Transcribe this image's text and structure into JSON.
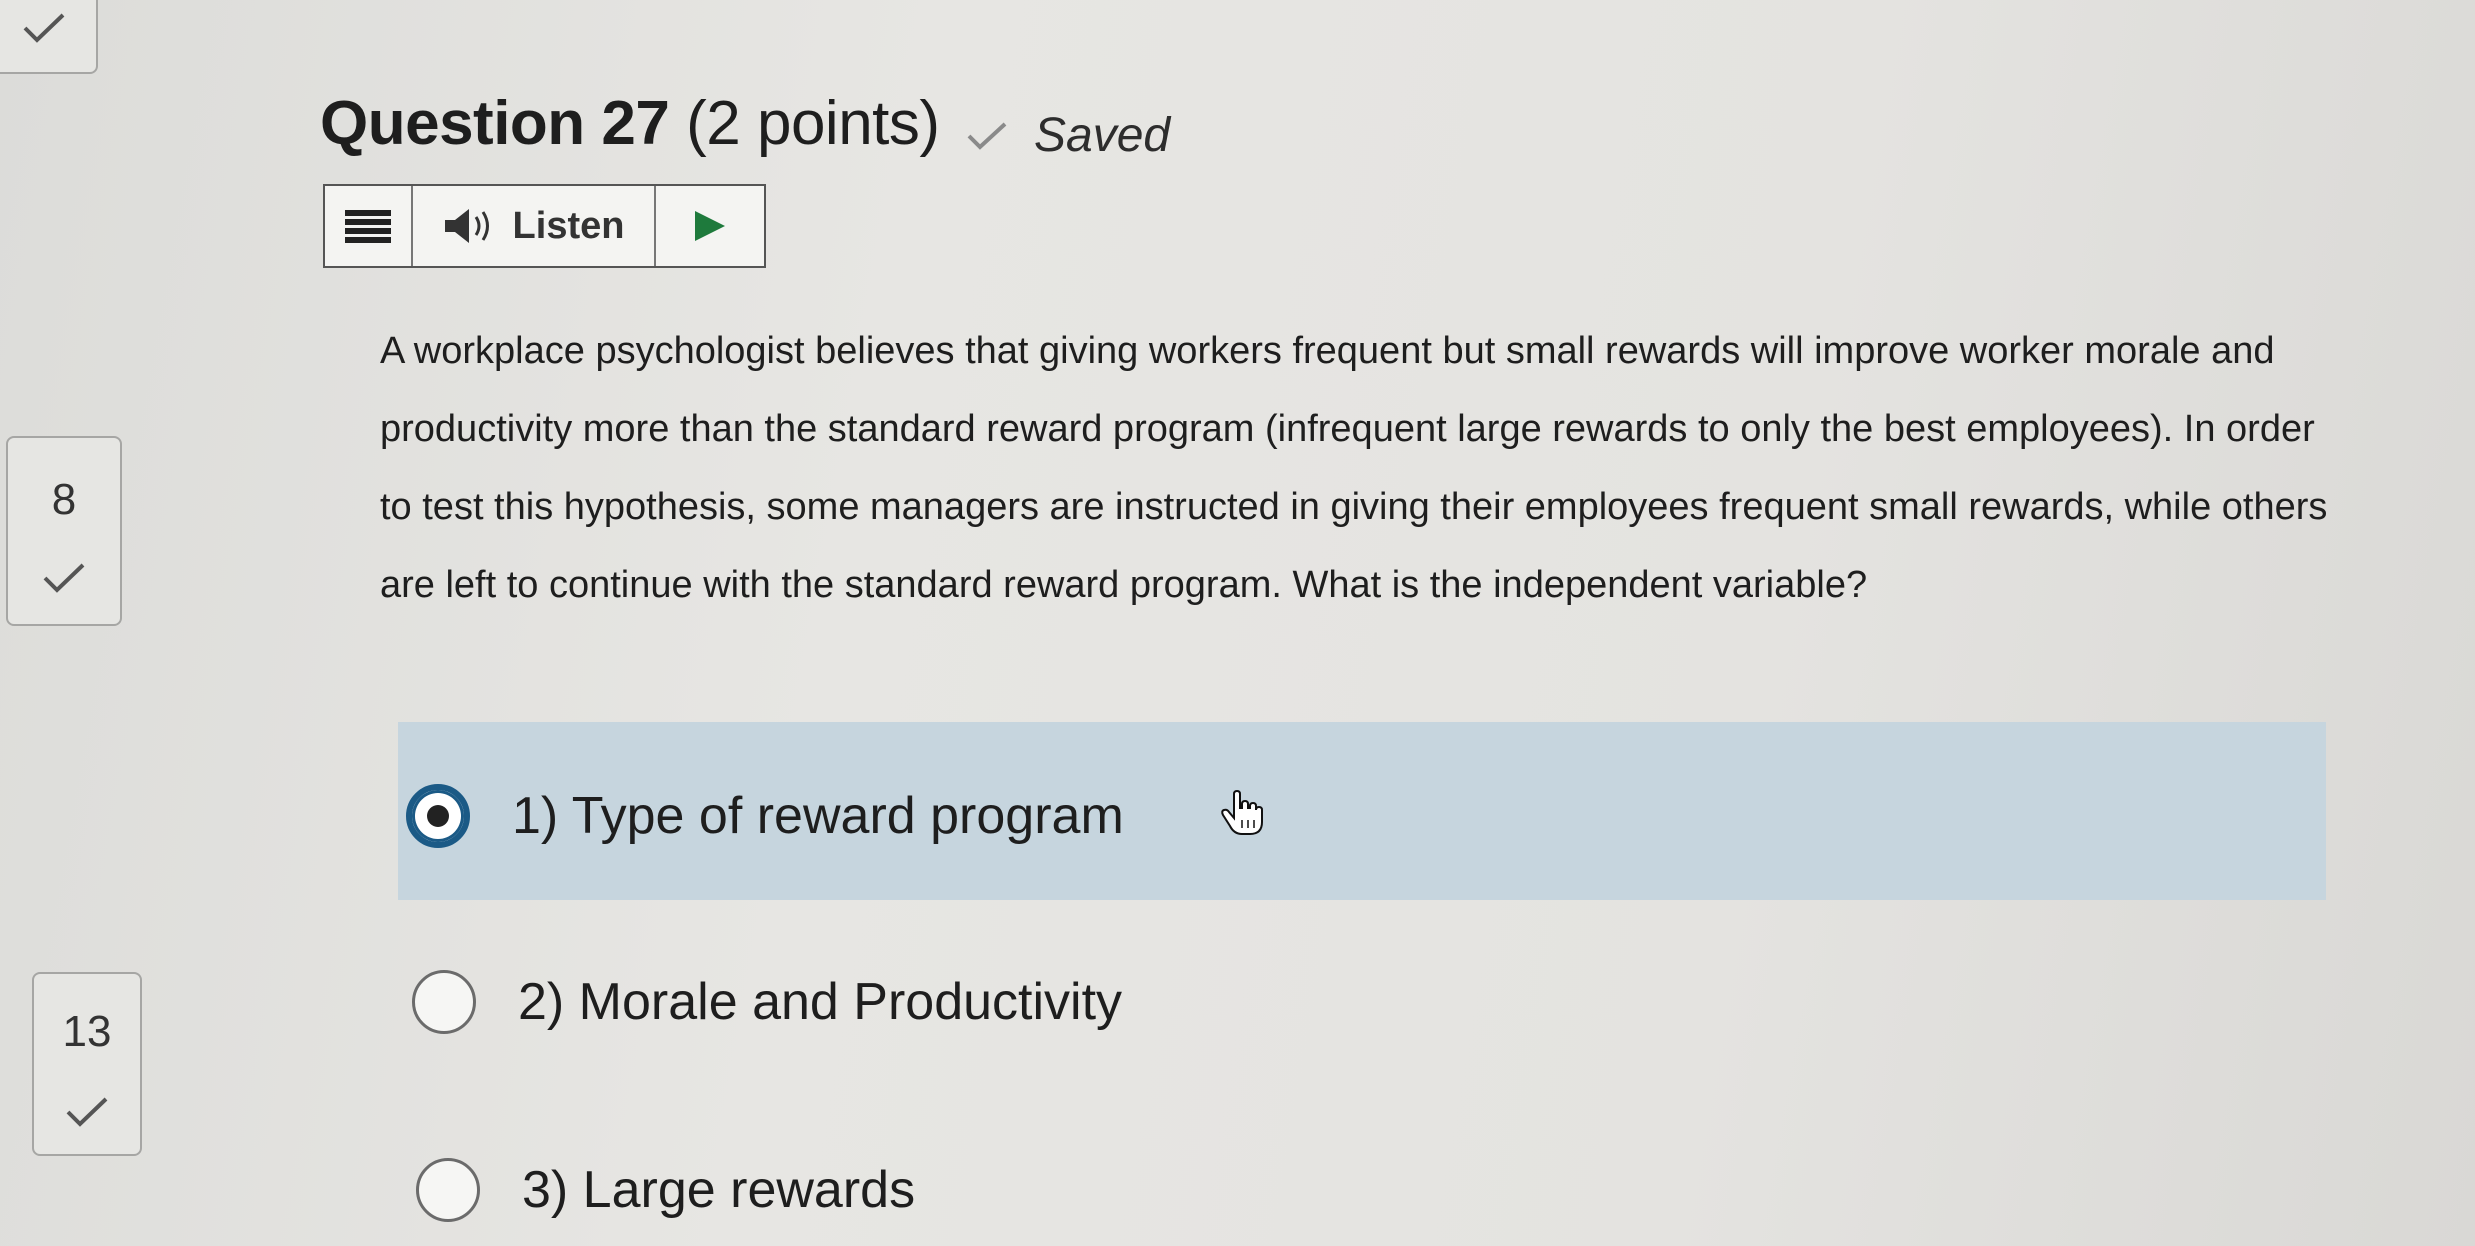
{
  "navigator": {
    "items": [
      {
        "number": "",
        "status": "answered"
      },
      {
        "number": "8",
        "status": "answered"
      },
      {
        "number": "13",
        "status": "answered"
      }
    ]
  },
  "question": {
    "title_number": "Question 27",
    "title_points": "(2 points)",
    "saved_label": "Saved",
    "text": "A workplace psychologist believes that giving workers frequent but small rewards will improve worker morale and productivity more than the standard reward program (infrequent large rewards to only the best employees). In order to test this hypothesis, some managers are instructed in giving their employees frequent small rewards, while others are left to continue with the standard reward program. What is the independent variable?"
  },
  "listen_toolbar": {
    "listen_label": "Listen"
  },
  "choices": [
    {
      "label": "1)  Type of reward program",
      "selected": true
    },
    {
      "label": "2)  Morale and Productivity",
      "selected": false
    },
    {
      "label": "3)  Large rewards",
      "selected": false
    }
  ],
  "colors": {
    "selected_choice_bg": "#c6d5de",
    "radio_selected_ring": "#1b5a86",
    "play_icon": "#1e7a3c"
  }
}
